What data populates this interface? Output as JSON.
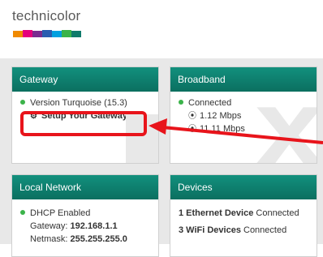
{
  "brand": {
    "name": "technicolor"
  },
  "gateway": {
    "title": "Gateway",
    "version": "Version Turquoise (15.3)",
    "setup_link": "Setup Your Gateway"
  },
  "broadband": {
    "title": "Broadband",
    "status": "Connected",
    "upload": "1.12 Mbps",
    "download": "11.11 Mbps"
  },
  "local_network": {
    "title": "Local Network",
    "dhcp": "DHCP Enabled",
    "gateway_label": "Gateway:",
    "gateway_value": "192.168.1.1",
    "netmask_label": "Netmask:",
    "netmask_value": "255.255.255.0"
  },
  "devices": {
    "title": "Devices",
    "ethernet_count": "1 Ethernet Device",
    "ethernet_status": "Connected",
    "wifi_count": "3 WiFi Devices",
    "wifi_status": "Connected"
  },
  "colors": {
    "accent": "#0f7b6b",
    "highlight": "#e8141b",
    "status_ok": "#3bb34a"
  }
}
